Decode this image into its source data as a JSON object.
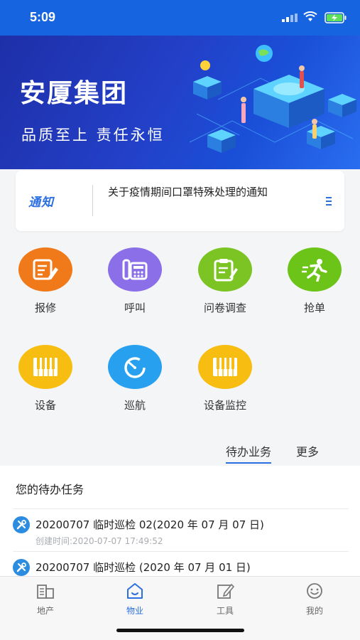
{
  "status_bar": {
    "time": "5:09",
    "icons": [
      "signal-icon",
      "wifi-icon",
      "battery-charging-icon"
    ]
  },
  "banner": {
    "title": "安厦集团",
    "slogan": "品质至上 责任永恒"
  },
  "notice": {
    "tag": "通知",
    "text": "关于疫情期间口罩特殊处理的通知"
  },
  "grid": [
    {
      "label": "报修",
      "icon": "repair-report-icon",
      "color": "#f07a1a"
    },
    {
      "label": "呼叫",
      "icon": "phone-call-icon",
      "color": "#8a6fe8"
    },
    {
      "label": "问卷调查",
      "icon": "clipboard-survey-icon",
      "color": "#7cc423"
    },
    {
      "label": "抢单",
      "icon": "running-grab-icon",
      "color": "#6cc418"
    },
    {
      "label": "设备",
      "icon": "equipment-icon",
      "color": "#f7bd10"
    },
    {
      "label": "巡航",
      "icon": "timer-patrol-icon",
      "color": "#28a0f0"
    },
    {
      "label": "设备监控",
      "icon": "equipment-monitor-icon",
      "color": "#f7bd10"
    }
  ],
  "tabs": [
    {
      "label": "待办业务",
      "active": true
    },
    {
      "label": "更多",
      "active": false
    }
  ],
  "tasks": {
    "heading": "您的待办任务",
    "items": [
      {
        "title": "20200707 临时巡检 02(2020 年 07 月 07 日)",
        "created": "创建时间:2020-07-07 17:49:52"
      },
      {
        "title": "20200707 临时巡检 (2020 年 07 月 01 日)",
        "created": ""
      }
    ]
  },
  "bottom_nav": [
    {
      "label": "地产",
      "icon": "building-icon",
      "active": false
    },
    {
      "label": "物业",
      "icon": "home-icon",
      "active": true
    },
    {
      "label": "工具",
      "icon": "edit-tool-icon",
      "active": false
    },
    {
      "label": "我的",
      "icon": "smiley-profile-icon",
      "active": false
    }
  ],
  "colors": {
    "primary": "#2b6fe0",
    "statusbar": "#1664e0"
  }
}
